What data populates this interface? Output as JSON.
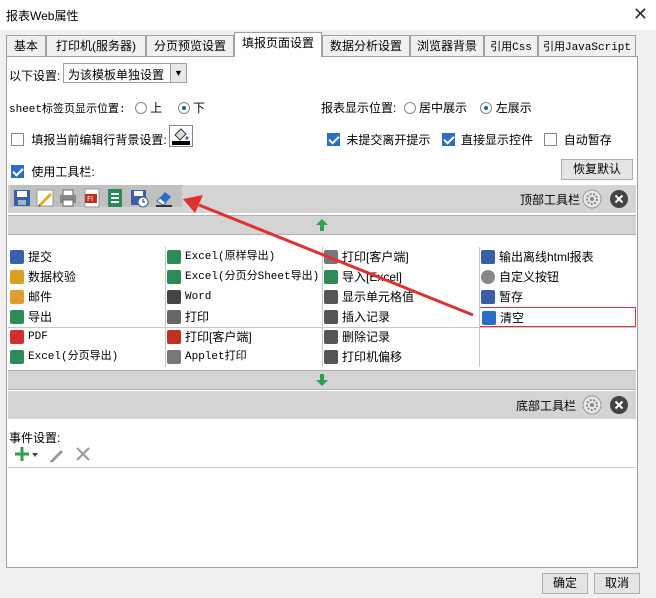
{
  "window": {
    "title": "报表Web属性"
  },
  "tabs": [
    {
      "label": "基本",
      "active": false
    },
    {
      "label": "打印机(服务器)",
      "active": false
    },
    {
      "label": "分页预览设置",
      "active": false
    },
    {
      "label": "填报页面设置",
      "active": true
    },
    {
      "label": "数据分析设置",
      "active": false
    },
    {
      "label": "浏览器背景",
      "active": false
    },
    {
      "label": "引用Css",
      "active": false
    },
    {
      "label": "引用JavaScript",
      "active": false
    }
  ],
  "settings": {
    "scope_label": "以下设置:",
    "scope_value": "为该模板单独设置",
    "sheet_pos_label": "sheet标签页显示位置:",
    "sheet_pos_top": "上",
    "sheet_pos_bottom": "下",
    "report_pos_label": "报表显示位置:",
    "report_pos_center": "居中展示",
    "report_pos_left": "左展示",
    "fill_bg_label": "填报当前编辑行背景设置:",
    "unsubmit_leave": "未提交离开提示",
    "direct_show": "直接显示控件",
    "auto_save": "自动暂存",
    "use_toolbar": "使用工具栏:",
    "restore_default": "恢复默认"
  },
  "top_toolbar": {
    "label": "顶部工具栏",
    "icons": [
      "save-icon",
      "pencil-icon",
      "printer-icon",
      "pdf-icon",
      "excel-icon",
      "save-clock-icon",
      "eraser-icon"
    ]
  },
  "bottom_toolbar": {
    "label": "底部工具栏"
  },
  "buttons": [
    [
      {
        "label": "提交",
        "icon": "save-icon",
        "color": "#3a5fa8"
      },
      {
        "label": "Excel(原样导出)",
        "icon": "excel-icon",
        "color": "#2e8b57",
        "mono": true
      },
      {
        "label": "打印[客户端]",
        "icon": "page-icon",
        "color": "#777"
      },
      {
        "label": "输出离线html报表",
        "icon": "html-icon",
        "color": "#3a5fa8"
      }
    ],
    [
      {
        "label": "数据校验",
        "icon": "pencil-icon",
        "color": "#d8a020"
      },
      {
        "label": "Excel(分页分Sheet导出)",
        "icon": "excel-icon",
        "color": "#2e8b57",
        "mono": true
      },
      {
        "label": "导入[Excel]",
        "icon": "excel-icon",
        "color": "#2e8b57"
      },
      {
        "label": "自定义按钮",
        "icon": "gear-icon",
        "color": "#888"
      }
    ],
    [
      {
        "label": "邮件",
        "icon": "mail-icon",
        "color": "#e0a030"
      },
      {
        "label": "Word",
        "icon": "word-icon",
        "color": "#444",
        "mono": true
      },
      {
        "label": "显示单元格值",
        "icon": "cell-icon",
        "color": "#555"
      },
      {
        "label": "暂存",
        "icon": "save-clock-icon",
        "color": "#3a5fa8"
      }
    ],
    [
      {
        "label": "导出",
        "icon": "export-icon",
        "color": "#2e8b57"
      },
      {
        "label": "打印",
        "icon": "printer-icon",
        "color": "#666"
      },
      {
        "label": "插入记录",
        "icon": "insert-row-icon",
        "color": "#555"
      },
      {
        "label": "清空",
        "icon": "eraser-icon",
        "color": "#2a6ec8",
        "selected": true
      }
    ],
    [
      {
        "label": "PDF",
        "icon": "pdf-icon",
        "color": "#d03030",
        "mono": true
      },
      {
        "label": "打印[客户端]",
        "icon": "pdf-print-icon",
        "color": "#c03020"
      },
      {
        "label": "删除记录",
        "icon": "delete-row-icon",
        "color": "#555"
      },
      {
        "label": "",
        "icon": "",
        "color": ""
      }
    ],
    [
      {
        "label": "Excel(分页导出)",
        "icon": "excel-icon",
        "color": "#2e8b57",
        "mono": true
      },
      {
        "label": "Applet打印",
        "icon": "applet-icon",
        "color": "#777",
        "mono": true
      },
      {
        "label": "打印机偏移",
        "icon": "move-icon",
        "color": "#555"
      },
      {
        "label": "",
        "icon": "",
        "color": ""
      }
    ]
  ],
  "events": {
    "label": "事件设置:"
  },
  "footer": {
    "ok": "确定",
    "cancel": "取消"
  },
  "colors": {
    "accent": "#2a6ec8",
    "green": "#2aa34a",
    "annotation": "#e03030"
  }
}
